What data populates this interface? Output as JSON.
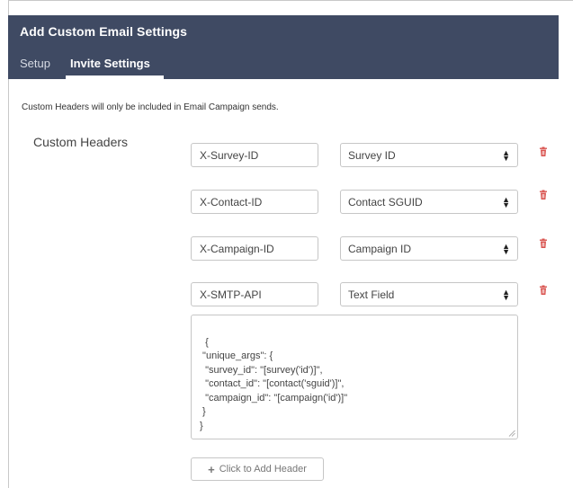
{
  "dialog": {
    "title": "Add Custom Email Settings",
    "tabs": [
      {
        "label": "Setup",
        "active": false
      },
      {
        "label": "Invite Settings",
        "active": true
      }
    ]
  },
  "note": "Custom Headers will only be included in Email Campaign sends.",
  "section_label": "Custom Headers",
  "headers": [
    {
      "name": "X-Survey-ID",
      "value": "Survey ID"
    },
    {
      "name": "X-Contact-ID",
      "value": "Contact SGUID"
    },
    {
      "name": "X-Campaign-ID",
      "value": "Campaign ID"
    },
    {
      "name": "X-SMTP-API",
      "value": "Text Field"
    }
  ],
  "text_field": "{\n \"unique_args\": {\n  \"survey_id\": \"[survey('id')]\",\n  \"contact_id\": \"[contact('sguid')]\",\n  \"campaign_id\": \"[campaign('id')]\"\n }\n}",
  "add_button_label": "Click to Add Header",
  "icons": {
    "delete": "trash-icon",
    "add": "plus-icon",
    "select": "select-arrows-icon"
  },
  "colors": {
    "header_bg": "#3f4a63",
    "trash": "#d9534f"
  }
}
